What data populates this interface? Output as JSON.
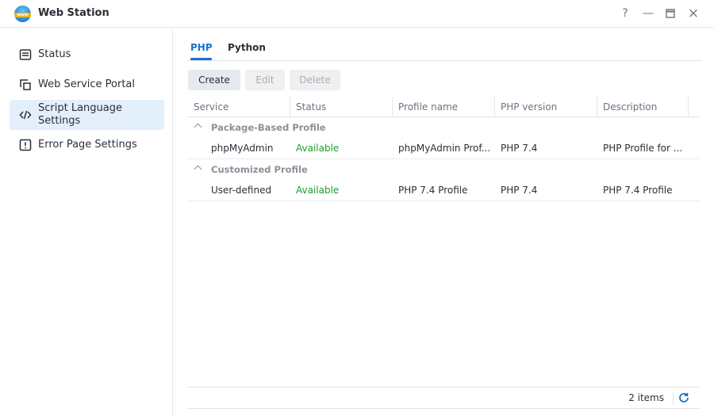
{
  "window": {
    "title": "Web Station",
    "app_icon_text": "www",
    "help": "?",
    "minimize": "—",
    "close": "×"
  },
  "sidebar": {
    "items": [
      {
        "label": "Status",
        "icon": "status-icon"
      },
      {
        "label": "Web Service Portal",
        "icon": "portal-icon"
      },
      {
        "label_line1": "Script Language",
        "label_line2": "Settings",
        "icon": "code-icon",
        "active": true
      },
      {
        "label": "Error Page Settings",
        "icon": "alert-icon"
      }
    ]
  },
  "tabs": [
    {
      "label": "PHP",
      "active": true
    },
    {
      "label": "Python",
      "active": false
    }
  ],
  "toolbar": {
    "create": "Create",
    "edit": "Edit",
    "delete": "Delete"
  },
  "table": {
    "columns": [
      "Service",
      "Status",
      "Profile name",
      "PHP version",
      "Description"
    ],
    "groups": [
      {
        "label": "Package-Based Profile",
        "rows": [
          {
            "service": "phpMyAdmin",
            "status": "Available",
            "profile": "phpMyAdmin Prof...",
            "version": "PHP 7.4",
            "description": "PHP Profile for ..."
          }
        ]
      },
      {
        "label": "Customized Profile",
        "rows": [
          {
            "service": "User-defined",
            "status": "Available",
            "profile": "PHP 7.4 Profile",
            "version": "PHP 7.4",
            "description": "PHP 7.4 Profile"
          }
        ]
      }
    ]
  },
  "footer": {
    "count": "2 items"
  },
  "colors": {
    "accent": "#1a73c9",
    "available": "#1f9d32",
    "active_bg": "#e3effb"
  }
}
